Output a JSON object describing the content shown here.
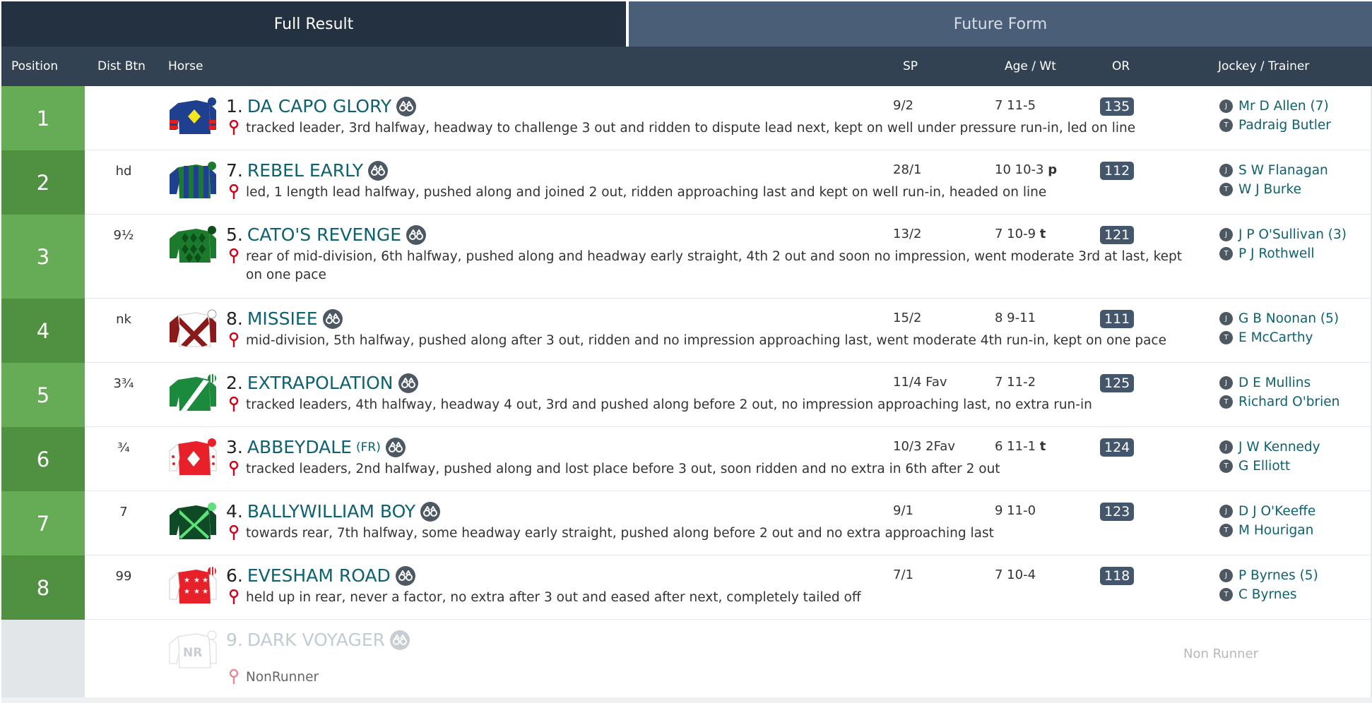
{
  "tabs": {
    "full_result": "Full Result",
    "future_form": "Future Form"
  },
  "columns": {
    "position": "Position",
    "dist_btn": "Dist Btn",
    "horse": "Horse",
    "sp": "SP",
    "age_wt": "Age / Wt",
    "or": "OR",
    "jockey_trainer": "Jockey / Trainer"
  },
  "jockey_badge": "J",
  "trainer_badge": "T",
  "rows": [
    {
      "position": "1",
      "dist": "",
      "number": "1.",
      "horse": "DA CAPO GLORY",
      "suffix": "",
      "comment": "tracked leader, 3rd halfway, headway to challenge 3 out and ridden to dispute lead next, kept on well under pressure run-in, led on line",
      "sp": "9/2",
      "age_wt": "7 11-5",
      "headgear": "",
      "or": "135",
      "jockey": "Mr D Allen (7)",
      "trainer": "Padraig Butler"
    },
    {
      "position": "2",
      "dist": "hd",
      "number": "7.",
      "horse": "REBEL EARLY",
      "suffix": "",
      "comment": "led, 1 length lead halfway, pushed along and joined 2 out, ridden approaching last and kept on well run-in, headed on line",
      "sp": "28/1",
      "age_wt": "10 10-3",
      "headgear": "p",
      "or": "112",
      "jockey": "S W Flanagan",
      "trainer": "W J Burke"
    },
    {
      "position": "3",
      "dist": "9½",
      "number": "5.",
      "horse": "CATO'S REVENGE",
      "suffix": "",
      "comment": "rear of mid-division, 6th halfway, pushed along and headway early straight, 4th 2 out and soon no impression, went moderate 3rd at last, kept on one pace",
      "sp": "13/2",
      "age_wt": "7 10-9",
      "headgear": "t",
      "or": "121",
      "jockey": "J P O'Sullivan (3)",
      "trainer": "P J Rothwell"
    },
    {
      "position": "4",
      "dist": "nk",
      "number": "8.",
      "horse": "MISSIEE",
      "suffix": "",
      "comment": "mid-division, 5th halfway, pushed along after 3 out, ridden and no impression approaching last, went moderate 4th run-in, kept on one pace",
      "sp": "15/2",
      "age_wt": "8 9-11",
      "headgear": "",
      "or": "111",
      "jockey": "G B Noonan (5)",
      "trainer": "E McCarthy"
    },
    {
      "position": "5",
      "dist": "3¾",
      "number": "2.",
      "horse": "EXTRAPOLATION",
      "suffix": "",
      "comment": "tracked leaders, 4th halfway, headway 4 out, 3rd and pushed along before 2 out, no impression approaching last, no extra run-in",
      "sp": "11/4 Fav",
      "age_wt": "7 11-2",
      "headgear": "",
      "or": "125",
      "jockey": "D E Mullins",
      "trainer": "Richard O'brien"
    },
    {
      "position": "6",
      "dist": "¾",
      "number": "3.",
      "horse": "ABBEYDALE",
      "suffix": "(FR)",
      "comment": "tracked leaders, 2nd halfway, pushed along and lost place before 3 out, soon ridden and no extra in 6th after 2 out",
      "sp": "10/3 2Fav",
      "age_wt": "6 11-1",
      "headgear": "t",
      "or": "124",
      "jockey": "J W Kennedy",
      "trainer": "G Elliott"
    },
    {
      "position": "7",
      "dist": "7",
      "number": "4.",
      "horse": "BALLYWILLIAM BOY",
      "suffix": "",
      "comment": "towards rear, 7th halfway, some headway early straight, pushed along before 2 out and no extra approaching last",
      "sp": "9/1",
      "age_wt": "9 11-0",
      "headgear": "",
      "or": "123",
      "jockey": "D J O'Keeffe",
      "trainer": "M Hourigan"
    },
    {
      "position": "8",
      "dist": "99",
      "number": "6.",
      "horse": "EVESHAM ROAD",
      "suffix": "",
      "comment": "held up in rear, never a factor, no extra after 3 out and eased after next, completely tailed off",
      "sp": "7/1",
      "age_wt": "7 10-4",
      "headgear": "",
      "or": "118",
      "jockey": "P Byrnes (5)",
      "trainer": "C Byrnes"
    }
  ],
  "non_runner": {
    "number": "9.",
    "horse": "DARK VOYAGER",
    "silk_label": "NR",
    "comment": "NonRunner",
    "status": "Non Runner"
  },
  "colors": {
    "tab_active": "#243140",
    "tab_inactive": "#4a5f77",
    "header": "#324253",
    "position_light": "#66ab55",
    "position_dark": "#4f9141",
    "link": "#0e6170",
    "or_badge": "#44566b",
    "pin": "#d0021b"
  },
  "icons": [
    "binoculars-icon",
    "map-pin-icon",
    "jockey-badge-icon",
    "trainer-badge-icon",
    "silk-icon"
  ]
}
